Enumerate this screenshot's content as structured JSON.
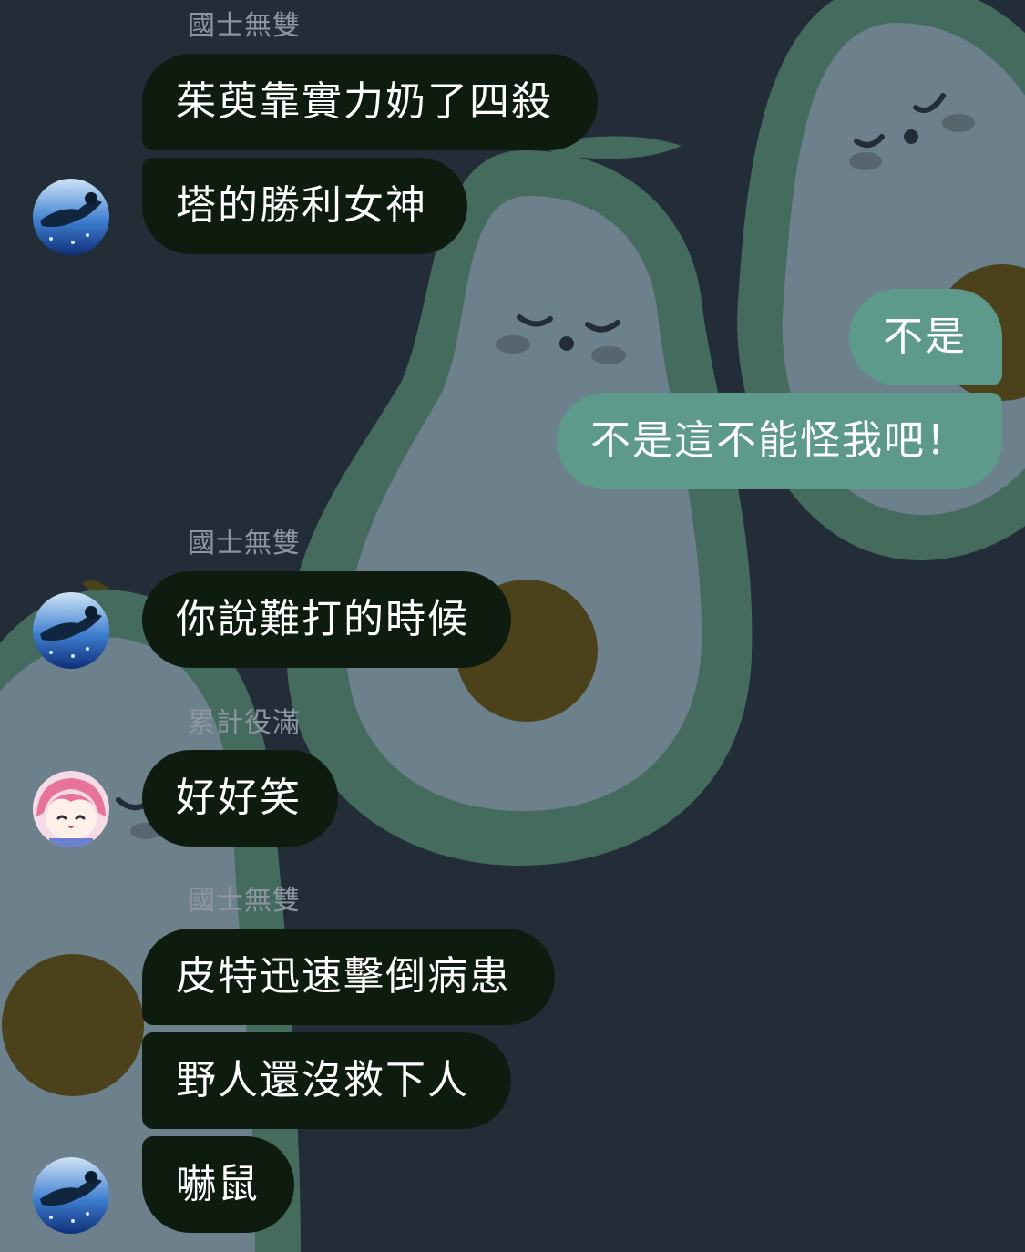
{
  "colors": {
    "background": "#232d38",
    "incoming_bubble": "#0e1b0f",
    "outgoing_bubble": "#5e9a8b",
    "sender_name": "#8c95a0"
  },
  "background_art": "avocado-pattern",
  "messages": [
    {
      "sender": "國士無雙",
      "avatar": "anime-boy-avatar",
      "lines": [
        "茱萸靠實力奶了四殺",
        "塔的勝利女神"
      ]
    },
    {
      "outgoing": [
        "不是",
        "不是這不能怪我吧！"
      ]
    },
    {
      "sender": "國士無雙",
      "avatar": "anime-boy-avatar",
      "lines": [
        "你說難打的時候"
      ]
    },
    {
      "sender": "累計役滿",
      "avatar": "pink-hair-girl-avatar",
      "lines": [
        "好好笑"
      ]
    },
    {
      "sender": "國士無雙",
      "avatar": "anime-boy-avatar",
      "lines": [
        "皮特迅速擊倒病患",
        "野人還沒救下人",
        "嚇鼠"
      ]
    }
  ]
}
